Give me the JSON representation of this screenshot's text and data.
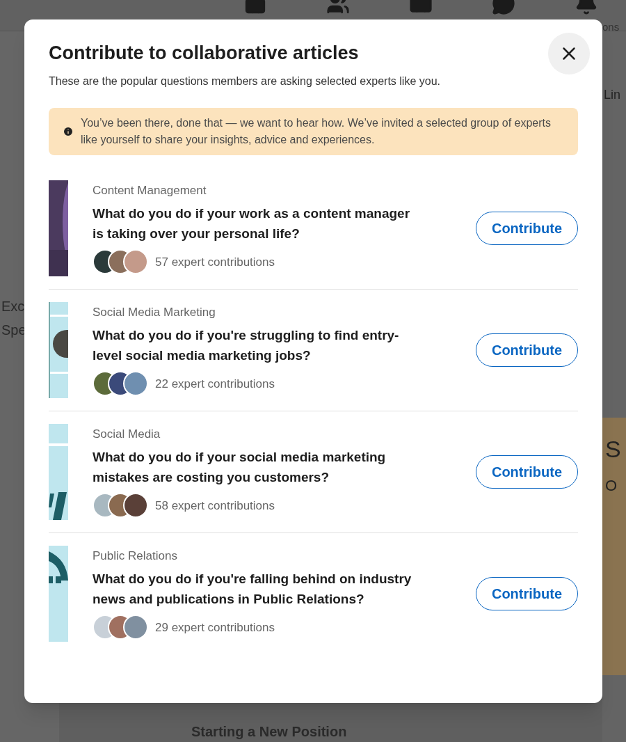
{
  "background": {
    "nav_label": "ons",
    "left_texts": [
      "Exc",
      "Spe"
    ],
    "right_heading": "Lin",
    "promo_texts": [
      "S",
      "O"
    ],
    "footer_text": "Starting a New Position"
  },
  "dialog": {
    "title": "Contribute to collaborative articles",
    "subtitle": "These are the popular questions members are asking selected experts like you.",
    "notice": "You’ve been there, done that — we want to hear how. We’ve invited a selected group of experts like yourself to share your insights, advice and experiences.",
    "articles": [
      {
        "topic": "Content Management",
        "question": "What do you do if your work as a content manager is taking over your personal life?",
        "contributions": "57 expert contributions",
        "button": "Contribute"
      },
      {
        "topic": "Social Media Marketing",
        "question": "What do you do if you're struggling to find entry-level social media marketing jobs?",
        "contributions": "22 expert contributions",
        "button": "Contribute"
      },
      {
        "topic": "Social Media",
        "question": "What do you do if your social media marketing mistakes are costing you customers?",
        "contributions": "58 expert contributions",
        "button": "Contribute"
      },
      {
        "topic": "Public Relations",
        "question": "What do you do if you're falling behind on industry news and publications in Public Relations?",
        "contributions": "29 expert contributions",
        "button": "Contribute"
      }
    ]
  }
}
